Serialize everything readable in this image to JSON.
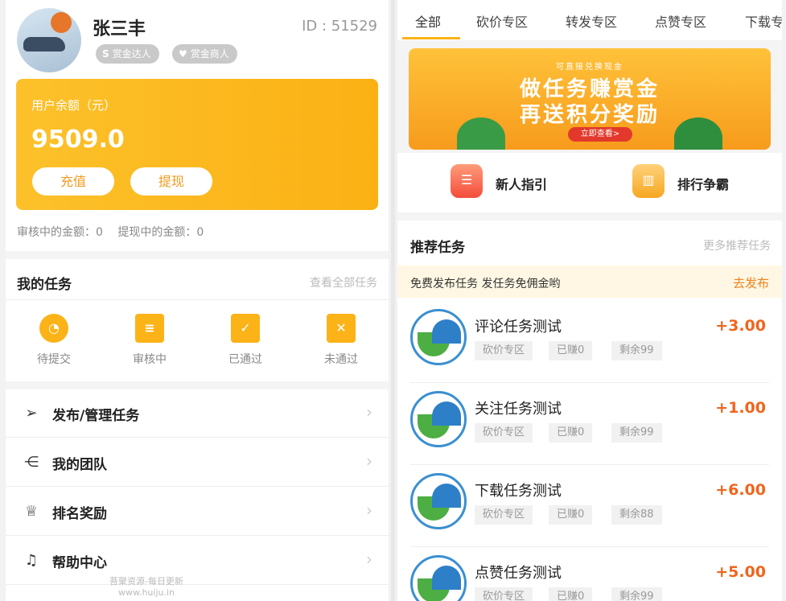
{
  "profile": {
    "name": "张三丰",
    "id_text": "ID : 51529",
    "badges": [
      "赏金达人",
      "赏金商人"
    ],
    "balance_label": "用户余额（元）",
    "balance_value": "9509.0",
    "recharge_label": "充值",
    "withdraw_label": "提现",
    "pending_review": "审核中的金额：0",
    "pending_withdraw": "提现中的金额：0"
  },
  "my_tasks": {
    "title": "我的任务",
    "more": "查看全部任务",
    "items": [
      {
        "label": "待提交",
        "icon": "clock-icon"
      },
      {
        "label": "审核中",
        "icon": "document-icon"
      },
      {
        "label": "已通过",
        "icon": "check-icon"
      },
      {
        "label": "未通过",
        "icon": "x-icon"
      }
    ]
  },
  "menu": [
    {
      "label": "发布/管理任务",
      "icon": "paper-plane-icon"
    },
    {
      "label": "我的团队",
      "icon": "share-icon"
    },
    {
      "label": "排名奖励",
      "icon": "trophy-icon"
    },
    {
      "label": "帮助中心",
      "icon": "bell-icon"
    }
  ],
  "watermark": [
    "菩聚资源-每日更新",
    "www.huiju.in"
  ],
  "tabs": [
    "全部",
    "砍价专区",
    "转发专区",
    "点赞专区",
    "下载专"
  ],
  "banner": {
    "small": "可直接兑换现金",
    "line1": "做任务赚赏金",
    "line2": "再送积分奖励",
    "button": "立即查看>"
  },
  "quick": [
    {
      "label": "新人指引",
      "icon": "guide-icon"
    },
    {
      "label": "排行争霸",
      "icon": "chart-icon"
    }
  ],
  "recommend": {
    "title": "推荐任务",
    "more": "更多推荐任务",
    "notice": "免费发布任务 发任务免佣金哟",
    "notice_action": "去发布",
    "tasks": [
      {
        "title": "评论任务测试",
        "tag": "砍价专区",
        "earned": "已赚0",
        "left": "剩余99",
        "amount": "+3.00"
      },
      {
        "title": "关注任务测试",
        "tag": "砍价专区",
        "earned": "已赚0",
        "left": "剩余99",
        "amount": "+1.00"
      },
      {
        "title": "下载任务测试",
        "tag": "砍价专区",
        "earned": "已赚0",
        "left": "剩余88",
        "amount": "+6.00"
      },
      {
        "title": "点赞任务测试",
        "tag": "砍价专区",
        "earned": "已赚0",
        "left": "剩余99",
        "amount": "+5.00"
      }
    ]
  }
}
